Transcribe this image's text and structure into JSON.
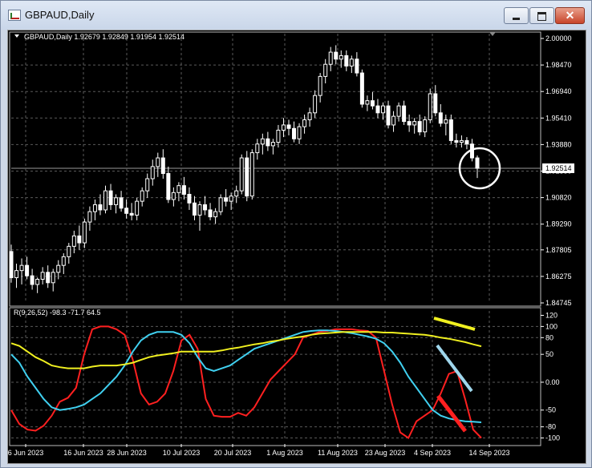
{
  "window": {
    "title": "GBPAUD,Daily",
    "close_glyph": "✕",
    "buttons": [
      "minimize",
      "maximize",
      "close"
    ]
  },
  "colors": {
    "background": "#000000",
    "candle": "#ffffff",
    "bull_fill": "#000000",
    "bear_fill": "#ffffff",
    "grid": "#5a5a5a",
    "rsi_red": "#ff2020",
    "rsi_cyan": "#40d0f0",
    "rsi_yellow": "#f0f020",
    "circle": "#ffffff"
  },
  "chart_data": {
    "type": "candlestick",
    "symbol_info": "GBPAUD,Daily  1.92679 1.92849 1.91954 1.92514",
    "price_axis": {
      "ylim": [
        1.84745,
        2.0
      ],
      "ticks": [
        "2.00000",
        "1.98470",
        "1.96940",
        "1.95410",
        "1.93880",
        "1.92350",
        "1.90820",
        "1.89290",
        "1.87805",
        "1.86275",
        "1.84745"
      ]
    },
    "current_price": "1.92514",
    "x_axis": {
      "ticks": [
        "6 Jun 2023",
        "16 Jun 2023",
        "28 Jun 2023",
        "10 Jul 2023",
        "20 Jul 2023",
        "1 Aug 2023",
        "11 Aug 2023",
        "23 Aug 2023",
        "4 Sep 2023",
        "14 Sep 2023"
      ]
    },
    "candles": [
      {
        "o": 1.8771,
        "h": 1.8811,
        "l": 1.8591,
        "c": 1.862
      },
      {
        "o": 1.862,
        "h": 1.8701,
        "l": 1.8561,
        "c": 1.8661
      },
      {
        "o": 1.8661,
        "h": 1.8731,
        "l": 1.8581,
        "c": 1.8691
      },
      {
        "o": 1.8691,
        "h": 1.8741,
        "l": 1.8611,
        "c": 1.8631
      },
      {
        "o": 1.8631,
        "h": 1.8671,
        "l": 1.8551,
        "c": 1.8581
      },
      {
        "o": 1.8581,
        "h": 1.8621,
        "l": 1.8531,
        "c": 1.8611
      },
      {
        "o": 1.8611,
        "h": 1.8681,
        "l": 1.8581,
        "c": 1.8651
      },
      {
        "o": 1.8651,
        "h": 1.8691,
        "l": 1.8561,
        "c": 1.8591
      },
      {
        "o": 1.8591,
        "h": 1.8671,
        "l": 1.8541,
        "c": 1.8651
      },
      {
        "o": 1.8651,
        "h": 1.8721,
        "l": 1.8611,
        "c": 1.8691
      },
      {
        "o": 1.8691,
        "h": 1.8761,
        "l": 1.8641,
        "c": 1.8741
      },
      {
        "o": 1.8741,
        "h": 1.8821,
        "l": 1.8701,
        "c": 1.8801
      },
      {
        "o": 1.8801,
        "h": 1.8891,
        "l": 1.8761,
        "c": 1.8861
      },
      {
        "o": 1.8861,
        "h": 1.8921,
        "l": 1.8781,
        "c": 1.8821
      },
      {
        "o": 1.8821,
        "h": 1.8961,
        "l": 1.8791,
        "c": 1.8941
      },
      {
        "o": 1.8941,
        "h": 1.9031,
        "l": 1.8891,
        "c": 1.9001
      },
      {
        "o": 1.9001,
        "h": 1.9071,
        "l": 1.8951,
        "c": 1.9041
      },
      {
        "o": 1.9041,
        "h": 1.9101,
        "l": 1.8981,
        "c": 1.9011
      },
      {
        "o": 1.9011,
        "h": 1.9151,
        "l": 1.8991,
        "c": 1.9121
      },
      {
        "o": 1.9121,
        "h": 1.9161,
        "l": 1.9011,
        "c": 1.9041
      },
      {
        "o": 1.9041,
        "h": 1.9101,
        "l": 1.8991,
        "c": 1.9081
      },
      {
        "o": 1.9081,
        "h": 1.9121,
        "l": 1.9001,
        "c": 1.9021
      },
      {
        "o": 1.9021,
        "h": 1.9071,
        "l": 1.8961,
        "c": 1.8991
      },
      {
        "o": 1.8991,
        "h": 1.9051,
        "l": 1.8951,
        "c": 1.8981
      },
      {
        "o": 1.8981,
        "h": 1.9081,
        "l": 1.8951,
        "c": 1.9061
      },
      {
        "o": 1.9061,
        "h": 1.9141,
        "l": 1.9031,
        "c": 1.9121
      },
      {
        "o": 1.9121,
        "h": 1.9221,
        "l": 1.9081,
        "c": 1.9191
      },
      {
        "o": 1.9191,
        "h": 1.9301,
        "l": 1.9151,
        "c": 1.9261
      },
      {
        "o": 1.9261,
        "h": 1.9341,
        "l": 1.9201,
        "c": 1.9311
      },
      {
        "o": 1.9311,
        "h": 1.9361,
        "l": 1.9191,
        "c": 1.9221
      },
      {
        "o": 1.9221,
        "h": 1.9261,
        "l": 1.9051,
        "c": 1.9071
      },
      {
        "o": 1.9071,
        "h": 1.9141,
        "l": 1.9031,
        "c": 1.9111
      },
      {
        "o": 1.9111,
        "h": 1.9171,
        "l": 1.9061,
        "c": 1.9151
      },
      {
        "o": 1.9151,
        "h": 1.9201,
        "l": 1.9071,
        "c": 1.9101
      },
      {
        "o": 1.9101,
        "h": 1.9141,
        "l": 1.9011,
        "c": 1.9051
      },
      {
        "o": 1.9051,
        "h": 1.9091,
        "l": 1.8951,
        "c": 1.8981
      },
      {
        "o": 1.8981,
        "h": 1.9061,
        "l": 1.8891,
        "c": 1.9041
      },
      {
        "o": 1.9041,
        "h": 1.9091,
        "l": 1.8981,
        "c": 1.9011
      },
      {
        "o": 1.9011,
        "h": 1.9051,
        "l": 1.8951,
        "c": 1.8971
      },
      {
        "o": 1.8971,
        "h": 1.9021,
        "l": 1.8931,
        "c": 1.9001
      },
      {
        "o": 1.9001,
        "h": 1.9101,
        "l": 1.8981,
        "c": 1.9081
      },
      {
        "o": 1.9081,
        "h": 1.9131,
        "l": 1.9031,
        "c": 1.9061
      },
      {
        "o": 1.9061,
        "h": 1.9111,
        "l": 1.9011,
        "c": 1.9091
      },
      {
        "o": 1.9091,
        "h": 1.9151,
        "l": 1.9051,
        "c": 1.9121
      },
      {
        "o": 1.9121,
        "h": 1.9331,
        "l": 1.9101,
        "c": 1.9311
      },
      {
        "o": 1.9311,
        "h": 1.9351,
        "l": 1.9061,
        "c": 1.9091
      },
      {
        "o": 1.9091,
        "h": 1.9361,
        "l": 1.9071,
        "c": 1.9341
      },
      {
        "o": 1.9341,
        "h": 1.9421,
        "l": 1.9301,
        "c": 1.9391
      },
      {
        "o": 1.9391,
        "h": 1.9451,
        "l": 1.9331,
        "c": 1.9421
      },
      {
        "o": 1.9421,
        "h": 1.9461,
        "l": 1.9351,
        "c": 1.9381
      },
      {
        "o": 1.9381,
        "h": 1.9421,
        "l": 1.9331,
        "c": 1.9401
      },
      {
        "o": 1.9401,
        "h": 1.9501,
        "l": 1.9371,
        "c": 1.9471
      },
      {
        "o": 1.9471,
        "h": 1.9541,
        "l": 1.9431,
        "c": 1.9501
      },
      {
        "o": 1.9501,
        "h": 1.9531,
        "l": 1.9441,
        "c": 1.9481
      },
      {
        "o": 1.9481,
        "h": 1.9521,
        "l": 1.9401,
        "c": 1.9421
      },
      {
        "o": 1.9421,
        "h": 1.9511,
        "l": 1.9391,
        "c": 1.9491
      },
      {
        "o": 1.9491,
        "h": 1.9561,
        "l": 1.9451,
        "c": 1.9531
      },
      {
        "o": 1.9531,
        "h": 1.9601,
        "l": 1.9491,
        "c": 1.9571
      },
      {
        "o": 1.9571,
        "h": 1.9701,
        "l": 1.9541,
        "c": 1.9671
      },
      {
        "o": 1.9671,
        "h": 1.9801,
        "l": 1.9631,
        "c": 1.9781
      },
      {
        "o": 1.9781,
        "h": 1.9881,
        "l": 1.9741,
        "c": 1.9851
      },
      {
        "o": 1.9851,
        "h": 1.9951,
        "l": 1.9811,
        "c": 1.9921
      },
      {
        "o": 1.9921,
        "h": 1.9961,
        "l": 1.9851,
        "c": 1.9881
      },
      {
        "o": 1.9881,
        "h": 1.9931,
        "l": 1.9831,
        "c": 1.9901
      },
      {
        "o": 1.9901,
        "h": 1.9931,
        "l": 1.9811,
        "c": 1.9841
      },
      {
        "o": 1.9841,
        "h": 1.9901,
        "l": 1.9801,
        "c": 1.9881
      },
      {
        "o": 1.9881,
        "h": 1.9921,
        "l": 1.9781,
        "c": 1.9801
      },
      {
        "o": 1.9801,
        "h": 1.9821,
        "l": 1.9601,
        "c": 1.9621
      },
      {
        "o": 1.9621,
        "h": 1.9671,
        "l": 1.9581,
        "c": 1.9641
      },
      {
        "o": 1.9641,
        "h": 1.9691,
        "l": 1.9591,
        "c": 1.9611
      },
      {
        "o": 1.9611,
        "h": 1.9651,
        "l": 1.9541,
        "c": 1.9571
      },
      {
        "o": 1.9571,
        "h": 1.9631,
        "l": 1.9531,
        "c": 1.9611
      },
      {
        "o": 1.9611,
        "h": 1.9641,
        "l": 1.9481,
        "c": 1.9501
      },
      {
        "o": 1.9501,
        "h": 1.9581,
        "l": 1.9461,
        "c": 1.9551
      },
      {
        "o": 1.9551,
        "h": 1.9631,
        "l": 1.9521,
        "c": 1.9611
      },
      {
        "o": 1.9611,
        "h": 1.9641,
        "l": 1.9501,
        "c": 1.9521
      },
      {
        "o": 1.9521,
        "h": 1.9561,
        "l": 1.9461,
        "c": 1.9501
      },
      {
        "o": 1.9501,
        "h": 1.9541,
        "l": 1.9451,
        "c": 1.9521
      },
      {
        "o": 1.9521,
        "h": 1.9561,
        "l": 1.9441,
        "c": 1.9461
      },
      {
        "o": 1.9461,
        "h": 1.9551,
        "l": 1.9431,
        "c": 1.9531
      },
      {
        "o": 1.9531,
        "h": 1.9711,
        "l": 1.9511,
        "c": 1.9681
      },
      {
        "o": 1.9681,
        "h": 1.9731,
        "l": 1.9551,
        "c": 1.9571
      },
      {
        "o": 1.9571,
        "h": 1.9621,
        "l": 1.9491,
        "c": 1.9511
      },
      {
        "o": 1.9511,
        "h": 1.9561,
        "l": 1.9441,
        "c": 1.9531
      },
      {
        "o": 1.9531,
        "h": 1.9561,
        "l": 1.9391,
        "c": 1.9411
      },
      {
        "o": 1.9411,
        "h": 1.9451,
        "l": 1.9371,
        "c": 1.9401
      },
      {
        "o": 1.9401,
        "h": 1.9441,
        "l": 1.9371,
        "c": 1.9411
      },
      {
        "o": 1.9411,
        "h": 1.9431,
        "l": 1.9361,
        "c": 1.9391
      },
      {
        "o": 1.9391,
        "h": 1.9421,
        "l": 1.9291,
        "c": 1.9311
      },
      {
        "o": 1.9311,
        "h": 1.9325,
        "l": 1.9195,
        "c": 1.9251
      }
    ],
    "indicator": {
      "label": "R(9,26,52) -98.3 -71.7 64.5",
      "ylim": [
        -105,
        125
      ],
      "ticks": [
        "120",
        "100",
        "80",
        "50",
        "0.00",
        "-50",
        "-80",
        "-100"
      ],
      "series": [
        {
          "color": "red",
          "values": [
            -50,
            -75,
            -85,
            -87,
            -78,
            -60,
            -35,
            -28,
            -10,
            50,
            95,
            100,
            100,
            95,
            85,
            40,
            -20,
            -40,
            -35,
            -20,
            20,
            75,
            85,
            60,
            -30,
            -60,
            -62,
            -62,
            -55,
            -60,
            -45,
            -20,
            5,
            20,
            35,
            50,
            80,
            85,
            90,
            92,
            95,
            95,
            95,
            93,
            92,
            80,
            20,
            -40,
            -90,
            -100,
            -70,
            -60,
            -50,
            -20,
            15,
            20,
            -30,
            -85,
            -100
          ]
        },
        {
          "color": "cyan",
          "values": [
            50,
            35,
            10,
            -10,
            -30,
            -45,
            -50,
            -48,
            -45,
            -40,
            -30,
            -20,
            -5,
            10,
            30,
            55,
            75,
            85,
            90,
            90,
            90,
            85,
            70,
            45,
            25,
            20,
            25,
            30,
            40,
            50,
            60,
            65,
            70,
            75,
            80,
            85,
            90,
            92,
            93,
            93,
            92,
            90,
            88,
            85,
            82,
            78,
            70,
            55,
            35,
            10,
            -10,
            -30,
            -50,
            -60,
            -65,
            -68,
            -70,
            -71,
            -72
          ]
        },
        {
          "color": "yellow",
          "values": [
            70,
            65,
            55,
            45,
            38,
            30,
            27,
            25,
            25,
            25,
            28,
            30,
            30,
            30,
            32,
            35,
            40,
            45,
            48,
            50,
            52,
            55,
            55,
            55,
            55,
            55,
            57,
            60,
            62,
            65,
            68,
            70,
            73,
            75,
            78,
            80,
            82,
            85,
            87,
            88,
            89,
            90,
            90,
            90,
            90,
            90,
            89,
            89,
            88,
            87,
            86,
            85,
            83,
            80,
            78,
            75,
            72,
            68,
            64.5
          ]
        }
      ]
    }
  }
}
